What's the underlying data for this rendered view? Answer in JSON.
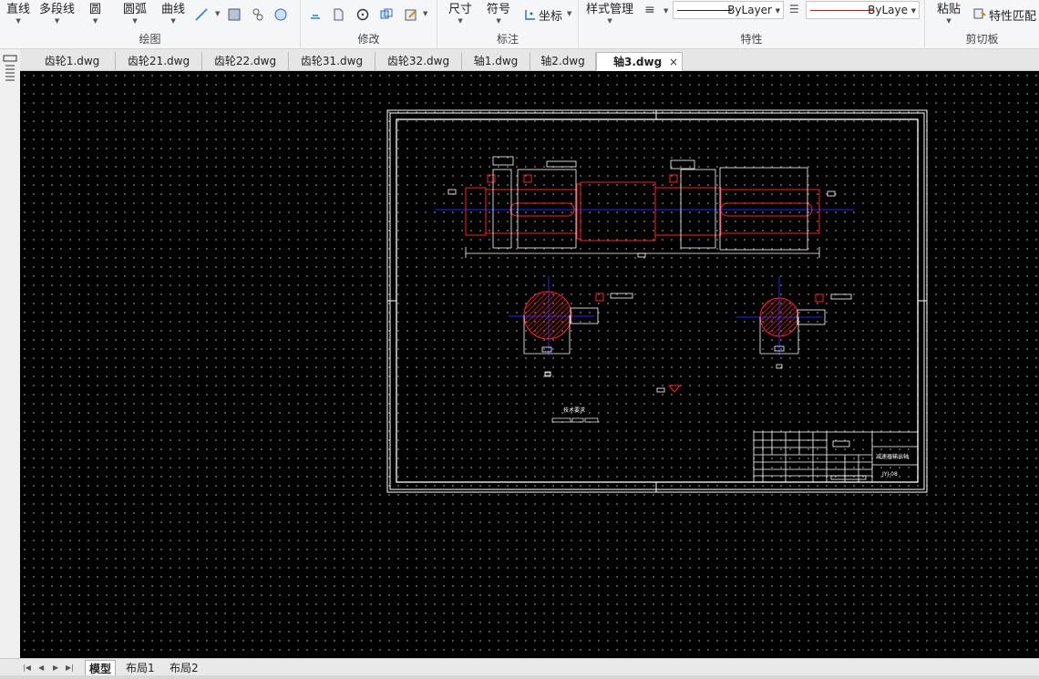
{
  "ribbon": {
    "draw": {
      "label": "绘图",
      "line": "直线",
      "polyline": "多段线",
      "circle": "圆",
      "arc": "圆弧",
      "curve": "曲线"
    },
    "modify": {
      "label": "修改"
    },
    "annotate": {
      "label": "标注",
      "dimension": "尺寸",
      "symbol": "符号",
      "coordinate": "坐标"
    },
    "properties": {
      "label": "特性",
      "style_manager": "样式管理",
      "linetype_value": "ByLayer",
      "lineweight_value": "ByLaye"
    },
    "clipboard": {
      "label": "剪切板",
      "paste": "粘贴",
      "match_properties": "特性匹配"
    }
  },
  "tabs": [
    {
      "label": "齿轮1.dwg"
    },
    {
      "label": "齿轮21.dwg"
    },
    {
      "label": "齿轮22.dwg"
    },
    {
      "label": "齿轮31.dwg"
    },
    {
      "label": "齿轮32.dwg"
    },
    {
      "label": "轴1.dwg"
    },
    {
      "label": "轴2.dwg"
    },
    {
      "label": "轴3.dwg",
      "active": true
    }
  ],
  "tab_close": "×",
  "layout_tabs": [
    {
      "label": "模型",
      "active": true
    },
    {
      "label": "布局1"
    },
    {
      "label": "布局2"
    }
  ],
  "drawing": {
    "tech_requirements": "技术要求",
    "title_block_name": "减速器输出轴",
    "title_block_code": "JYJ-08"
  },
  "colors": {
    "accent_red": "#ff2020",
    "center_blue": "#1a2cff",
    "frame_white": "#ffffff",
    "canvas_bg": "#000000"
  }
}
